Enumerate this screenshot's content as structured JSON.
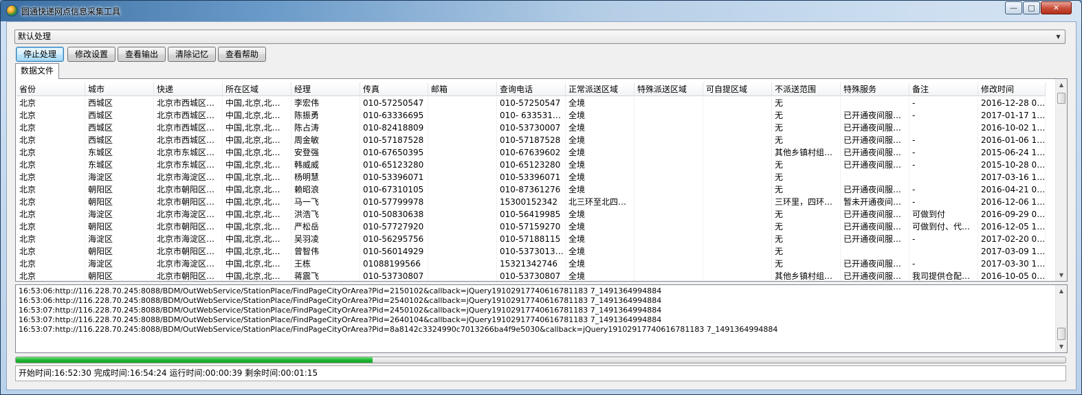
{
  "window": {
    "title": "圆通快递网点信息采集工具",
    "minimize_glyph": "—",
    "maximize_glyph": "□",
    "close_glyph": "✕"
  },
  "mode_select": {
    "value": "默认处理",
    "arrow_glyph": "▼"
  },
  "toolbar": {
    "buttons": [
      {
        "label": "停止处理"
      },
      {
        "label": "修改设置"
      },
      {
        "label": "查看输出"
      },
      {
        "label": "清除记忆"
      },
      {
        "label": "查看帮助"
      }
    ]
  },
  "tab": {
    "label": "数据文件"
  },
  "table": {
    "columns": [
      "省份",
      "城市",
      "快递",
      "所在区域",
      "经理",
      "传真",
      "邮箱",
      "查询电话",
      "正常派送区域",
      "特殊派送区域",
      "可自提区域",
      "不派送范围",
      "特殊服务",
      "备注",
      "修改时间"
    ],
    "rows": [
      [
        "北京",
        "西城区",
        "北京市西城区…",
        "中国,北京,北…",
        "李宏伟",
        "010-57250547",
        "",
        "010-57250547",
        "全境",
        "",
        "",
        "无",
        "",
        "-",
        "2016-12-28 0…"
      ],
      [
        "北京",
        "西城区",
        "北京市西城区…",
        "中国,北京,北…",
        "陈振勇",
        "010-63336695",
        "",
        "010- 633531…",
        "全境",
        "",
        "",
        "无",
        "已开通夜间服…",
        "-",
        "2017-01-17 1…"
      ],
      [
        "北京",
        "西城区",
        "北京市西城区…",
        "中国,北京,北…",
        "陈占涛",
        "010-82418809",
        "",
        "010-53730007",
        "全境",
        "",
        "",
        "无",
        "已开通夜间服…",
        "",
        "2016-10-02 1…"
      ],
      [
        "北京",
        "西城区",
        "北京市西城区…",
        "中国,北京,北…",
        "周金敏",
        "010-57187528",
        "",
        "010-57187528",
        "全境",
        "",
        "",
        "无",
        "已开通夜间服…",
        "-",
        "2016-01-06 1…"
      ],
      [
        "北京",
        "东城区",
        "北京市东城区…",
        "中国,北京,北…",
        "安登强",
        "010-67650395",
        "",
        "010-67639602",
        "全境",
        "",
        "",
        "其他乡镇村组…",
        "已开通夜间服…",
        "-",
        "2015-06-24 1…"
      ],
      [
        "北京",
        "东城区",
        "北京市东城区…",
        "中国,北京,北…",
        "韩威威",
        "010-65123280",
        "",
        "010-65123280",
        "全境",
        "",
        "",
        "无",
        "已开通夜间服…",
        "-",
        "2015-10-28 0…"
      ],
      [
        "北京",
        "海淀区",
        "北京市海淀区…",
        "中国,北京,北…",
        "杨明慧",
        "010-53396071",
        "",
        "010-53396071",
        "全境",
        "",
        "",
        "无",
        "",
        "",
        "2017-03-16 1…"
      ],
      [
        "北京",
        "朝阳区",
        "北京市朝阳区…",
        "中国,北京,北…",
        "赖昭浪",
        "010-67310105",
        "",
        "010-87361276",
        "全境",
        "",
        "",
        "无",
        "已开通夜间服…",
        "-",
        "2016-04-21 0…"
      ],
      [
        "北京",
        "朝阳区",
        "北京市朝阳区…",
        "中国,北京,北…",
        "马一飞",
        "010-57799978",
        "",
        "15300152342",
        "北三环至北四…",
        "",
        "",
        "三环里，四环…",
        "暂未开通夜间…",
        "-",
        "2016-12-06 1…"
      ],
      [
        "北京",
        "海淀区",
        "北京市海淀区…",
        "中国,北京,北…",
        "洪浩飞",
        "010-50830638",
        "",
        "010-56419985",
        "全境",
        "",
        "",
        "无",
        "已开通夜间服…",
        "可做到付",
        "2016-09-29 0…"
      ],
      [
        "北京",
        "朝阳区",
        "北京市朝阳区…",
        "中国,北京,北…",
        "严松岳",
        "010-57727920",
        "",
        "010-57159270",
        "全境",
        "",
        "",
        "无",
        "已开通夜间服…",
        "可做到付、代…",
        "2016-12-05 1…"
      ],
      [
        "北京",
        "海淀区",
        "北京市海淀区…",
        "中国,北京,北…",
        "吴羽凌",
        "010-56295756",
        "",
        "010-57188115",
        "全境",
        "",
        "",
        "无",
        "已开通夜间服…",
        "-",
        "2017-02-20 0…"
      ],
      [
        "北京",
        "朝阳区",
        "北京市朝阳区…",
        "中国,北京,北…",
        "曾智伟",
        "010-56014929",
        "",
        "010-5373013…",
        "全境",
        "",
        "",
        "无",
        "",
        "",
        "2017-03-09 1…"
      ],
      [
        "北京",
        "海淀区",
        "北京市海淀区…",
        "中国,北京,北…",
        "王栋",
        "01088199566",
        "",
        "15321342746",
        "全境",
        "",
        "",
        "无",
        "已开通夜间服…",
        "-",
        "2017-03-30 1…"
      ],
      [
        "北京",
        "朝阳区",
        "北京市朝阳区…",
        "中国,北京,北…",
        "蒋震飞",
        "010-53730807",
        "",
        "010-53730807",
        "全境",
        "",
        "",
        "其他乡镇村组…",
        "已开通夜间服…",
        "我司提供仓配…",
        "2016-10-05 0…"
      ]
    ]
  },
  "log": {
    "lines": [
      "16:53:06:http://116.228.70.245:8088/BDM/OutWebService/StationPlace/FindPageCityOrArea?Pid=2150102&callback=jQuery19102917740616781183 7_1491364994884",
      "16:53:06:http://116.228.70.245:8088/BDM/OutWebService/StationPlace/FindPageCityOrArea?Pid=2540102&callback=jQuery19102917740616781183 7_1491364994884",
      "16:53:07:http://116.228.70.245:8088/BDM/OutWebService/StationPlace/FindPageCityOrArea?Pid=2450102&callback=jQuery19102917740616781183 7_1491364994884",
      "16:53:07:http://116.228.70.245:8088/BDM/OutWebService/StationPlace/FindPageCityOrArea?Pid=2640104&callback=jQuery19102917740616781183 7_1491364994884",
      "16:53:07:http://116.228.70.245:8088/BDM/OutWebService/StationPlace/FindPageCityOrArea?Pid=8a8142c3324990c7013266ba4f9e5030&callback=jQuery19102917740616781183 7_1491364994884"
    ]
  },
  "progress": {
    "fraction": 0.34,
    "color": "#1db531"
  },
  "status": {
    "text": "开始时间:16:52:30 完成时间:16:54:24 运行时间:00:00:39 剩余时间:00:01:15"
  },
  "scroll": {
    "up_glyph": "▲",
    "down_glyph": "▼"
  }
}
